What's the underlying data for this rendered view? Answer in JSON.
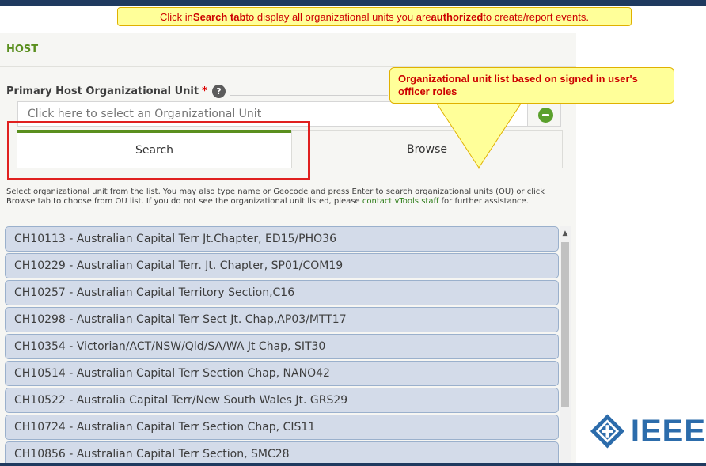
{
  "banner": {
    "part1": "Click in ",
    "bold1": "Search tab",
    "part2": " to display all organizational units you are ",
    "bold2": "authorized",
    "part3": " to create/report events."
  },
  "section": {
    "title": "HOST"
  },
  "field": {
    "label": "Primary Host Organizational Unit",
    "required_mark": "*",
    "help_glyph": "?",
    "placeholder": "Click here to select an Organizational Unit"
  },
  "tabs": {
    "search": "Search",
    "browse": "Browse"
  },
  "help_text": {
    "main": "Select organizational unit from the list. You may also type name or Geocode and press Enter to search organizational units (OU) or click Browse tab to choose from OU list. If you do not see the organizational unit listed, please ",
    "link": "contact vTools staff",
    "tail": " for further assistance."
  },
  "callout": {
    "text": "Organizational unit list based on signed in user's officer roles"
  },
  "units": [
    "CH10113 - Australian Capital Terr Jt.Chapter, ED15/PHO36",
    "CH10229 - Australian Capital Terr. Jt. Chapter, SP01/COM19",
    "CH10257 - Australian Capital Territory Section,C16",
    "CH10298 - Australian Capital Terr Sect Jt. Chap,AP03/MTT17",
    "CH10354 - Victorian/ACT/NSW/Qld/SA/WA Jt Chap, SIT30",
    "CH10514 - Australian Capital Terr Section Chap, NANO42",
    "CH10522 - Australia Capital Terr/New South Wales Jt. GRS29",
    "CH10724 - Australian Capital Terr Section Chap, CIS11",
    "CH10856 - Australian Capital Terr Section, SMC28"
  ],
  "logo": {
    "text": "IEEE"
  },
  "colors": {
    "accent_green": "#5a8f1e",
    "highlight_red": "#e0201f",
    "callout_fill": "#ffff99",
    "callout_text": "#cc0000",
    "list_item_fill": "#d3dbe9",
    "ieee_blue": "#2c6cab"
  },
  "icons": {
    "help": "question-circle-icon",
    "minus": "minus-circle-icon",
    "scroll_up": "chevron-up-icon",
    "logo": "ieee-diamond-icon"
  }
}
